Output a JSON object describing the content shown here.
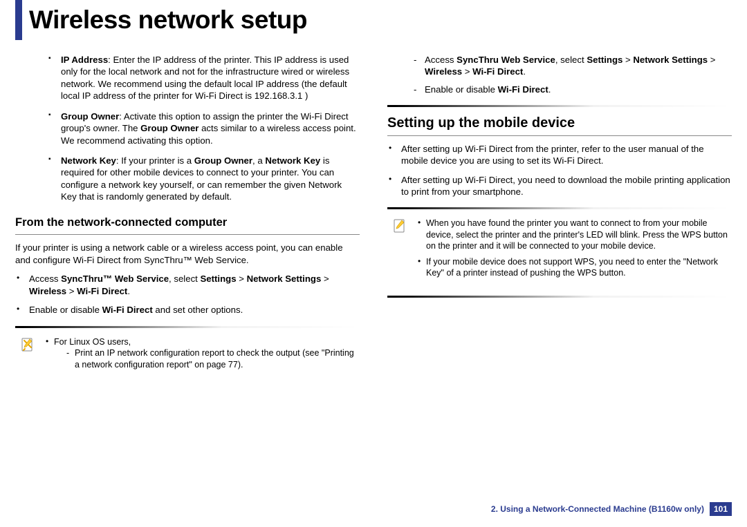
{
  "title": "Wireless network setup",
  "left": {
    "items": [
      {
        "label": "IP Address",
        "text": ": Enter the IP address of the printer. This IP address is used only for the local network and not for the infrastructure wired or wireless network. We recommend using the default local IP address (the default local IP address of the printer for Wi-Fi Direct is 192.168.3.1 )"
      },
      {
        "label": "Group Owner",
        "text_pre": ": Activate this option to assign the printer the Wi-Fi Direct group's owner. The ",
        "label2": "Group Owner",
        "text_post": " acts similar to a wireless access point. We recommend activating this option."
      },
      {
        "label": "Network Key",
        "text_pre": ": If your printer is a ",
        "label2": "Group Owner",
        "mid": ", a ",
        "label3": "Network Key",
        "text_post": " is required for other mobile devices to connect to your printer. You can configure a network key yourself, or can remember the given Network Key that is randomly generated by default."
      }
    ],
    "h3": "From the network-connected computer",
    "para": "If your printer is using a network cable or a wireless access point, you can enable and configure Wi-Fi Direct from SyncThru™ Web Service.",
    "steps": [
      {
        "pre": "Access ",
        "b1": "SyncThru™ Web Service",
        "mid1": ", select ",
        "b2": "Settings",
        "gt1": " > ",
        "b3": "Network Settings",
        "gt2": " > ",
        "b4": "Wireless",
        "gt3": " > ",
        "b5": "Wi-Fi Direct",
        "post": "."
      },
      {
        "pre": "Enable or disable ",
        "b1": "Wi-Fi Direct",
        "post": " and set other options."
      }
    ],
    "note": {
      "line1": "For Linux OS users,",
      "dash1_pre": "Print an IP network configuration report to check the output (see \"Printing a network configuration report\" on page 77)."
    }
  },
  "right": {
    "top_dashes": [
      {
        "pre": "Access ",
        "b1": "SyncThru Web Service",
        "mid1": ", select ",
        "b2": "Settings",
        "gt1": " > ",
        "b3": "Network Settings",
        "gt2": " > ",
        "b4": "Wireless",
        "gt3": " > ",
        "b5": "Wi-Fi Direct",
        "post": "."
      },
      {
        "pre": "Enable or disable ",
        "b1": "Wi-Fi Direct",
        "post": "."
      }
    ],
    "h2": "Setting up the mobile device",
    "bullets": [
      "After setting up Wi-Fi Direct from the printer, refer to the user manual of the mobile device you are using to set its Wi-Fi Direct.",
      "After setting up Wi-Fi Direct, you need to download the mobile printing application to print from your smartphone."
    ],
    "note": {
      "b1": "When you have found the printer you want to connect to from your mobile device, select the printer and the printer's LED will blink. Press the WPS button on the printer and it will be connected to your mobile device.",
      "b2": " If your mobile device does not support WPS, you need to enter the \"Network Key\" of a printer instead of pushing the WPS button."
    }
  },
  "footer": {
    "chapter": "2.  Using a Network-Connected Machine (B1160w only)",
    "page": "101"
  }
}
